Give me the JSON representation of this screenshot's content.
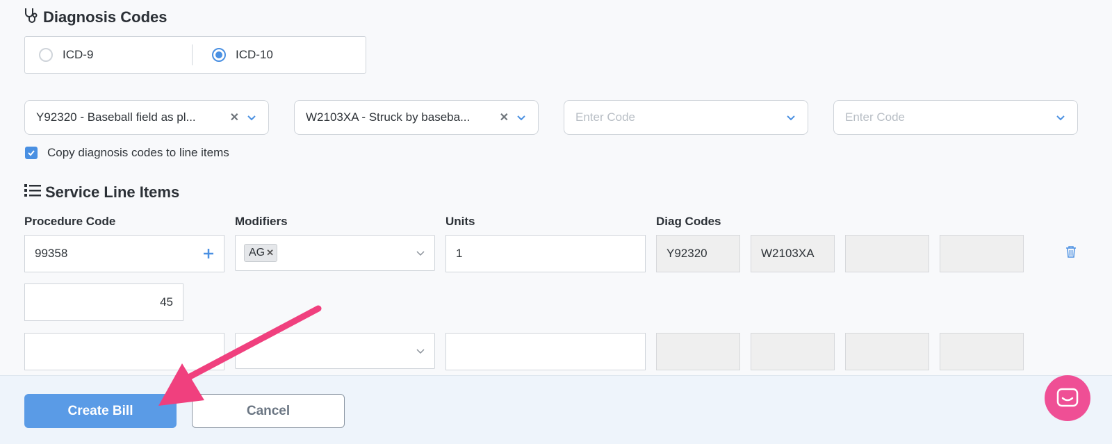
{
  "diagnosis": {
    "title": "Diagnosis Codes",
    "icd9_label": "ICD-9",
    "icd10_label": "ICD-10",
    "code1": "Y92320 - Baseball field as pl...",
    "code2": "W2103XA - Struck by baseba...",
    "code3_placeholder": "Enter Code",
    "code4_placeholder": "Enter Code",
    "copy_label": "Copy diagnosis codes to line items"
  },
  "service": {
    "title": "Service Line Items",
    "headers": {
      "procedure": "Procedure Code",
      "modifiers": "Modifiers",
      "units": "Units",
      "diag": "Diag Codes"
    },
    "row1": {
      "procedure": "99358",
      "modifier_tag": "AG",
      "units": "1",
      "diag1": "Y92320",
      "diag2": "W2103XA",
      "diag3": "",
      "diag4": "",
      "amount": "45"
    }
  },
  "footer": {
    "create_label": "Create Bill",
    "cancel_label": "Cancel"
  },
  "colors": {
    "accent": "#4a90e2",
    "arrow": "#f0407e",
    "chat": "#ef4f95"
  }
}
